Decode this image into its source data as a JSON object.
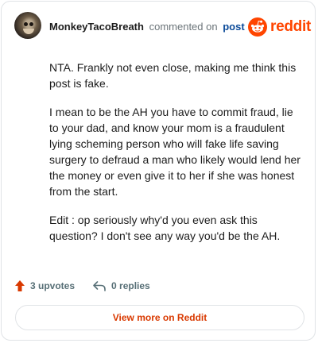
{
  "header": {
    "username": "MonkeyTacoBreath",
    "commented_text": "commented on",
    "post_link": "post"
  },
  "brand": {
    "name": "reddit",
    "logo_icon": "reddit-alien-icon",
    "color": "#ff4500"
  },
  "comment": {
    "paragraphs": [
      "NTA. Frankly not even close, making me think this post is fake.",
      "I mean to be the AH you have to commit fraud, lie to your dad, and know your mom is a fraudulent lying scheming person who will fake life saving surgery to defraud a man who likely would lend her the money or even give it to her if she was honest from the start.",
      "Edit : op seriously why'd you even ask this question? I don't see any way you'd be the AH."
    ]
  },
  "stats": {
    "upvotes": "3 upvotes",
    "upvote_icon": "upvote-arrow-icon",
    "replies": "0 replies",
    "reply_icon": "reply-arrow-icon"
  },
  "actions": {
    "view_more_label": "View more on Reddit",
    "accent_color": "#d93900"
  }
}
